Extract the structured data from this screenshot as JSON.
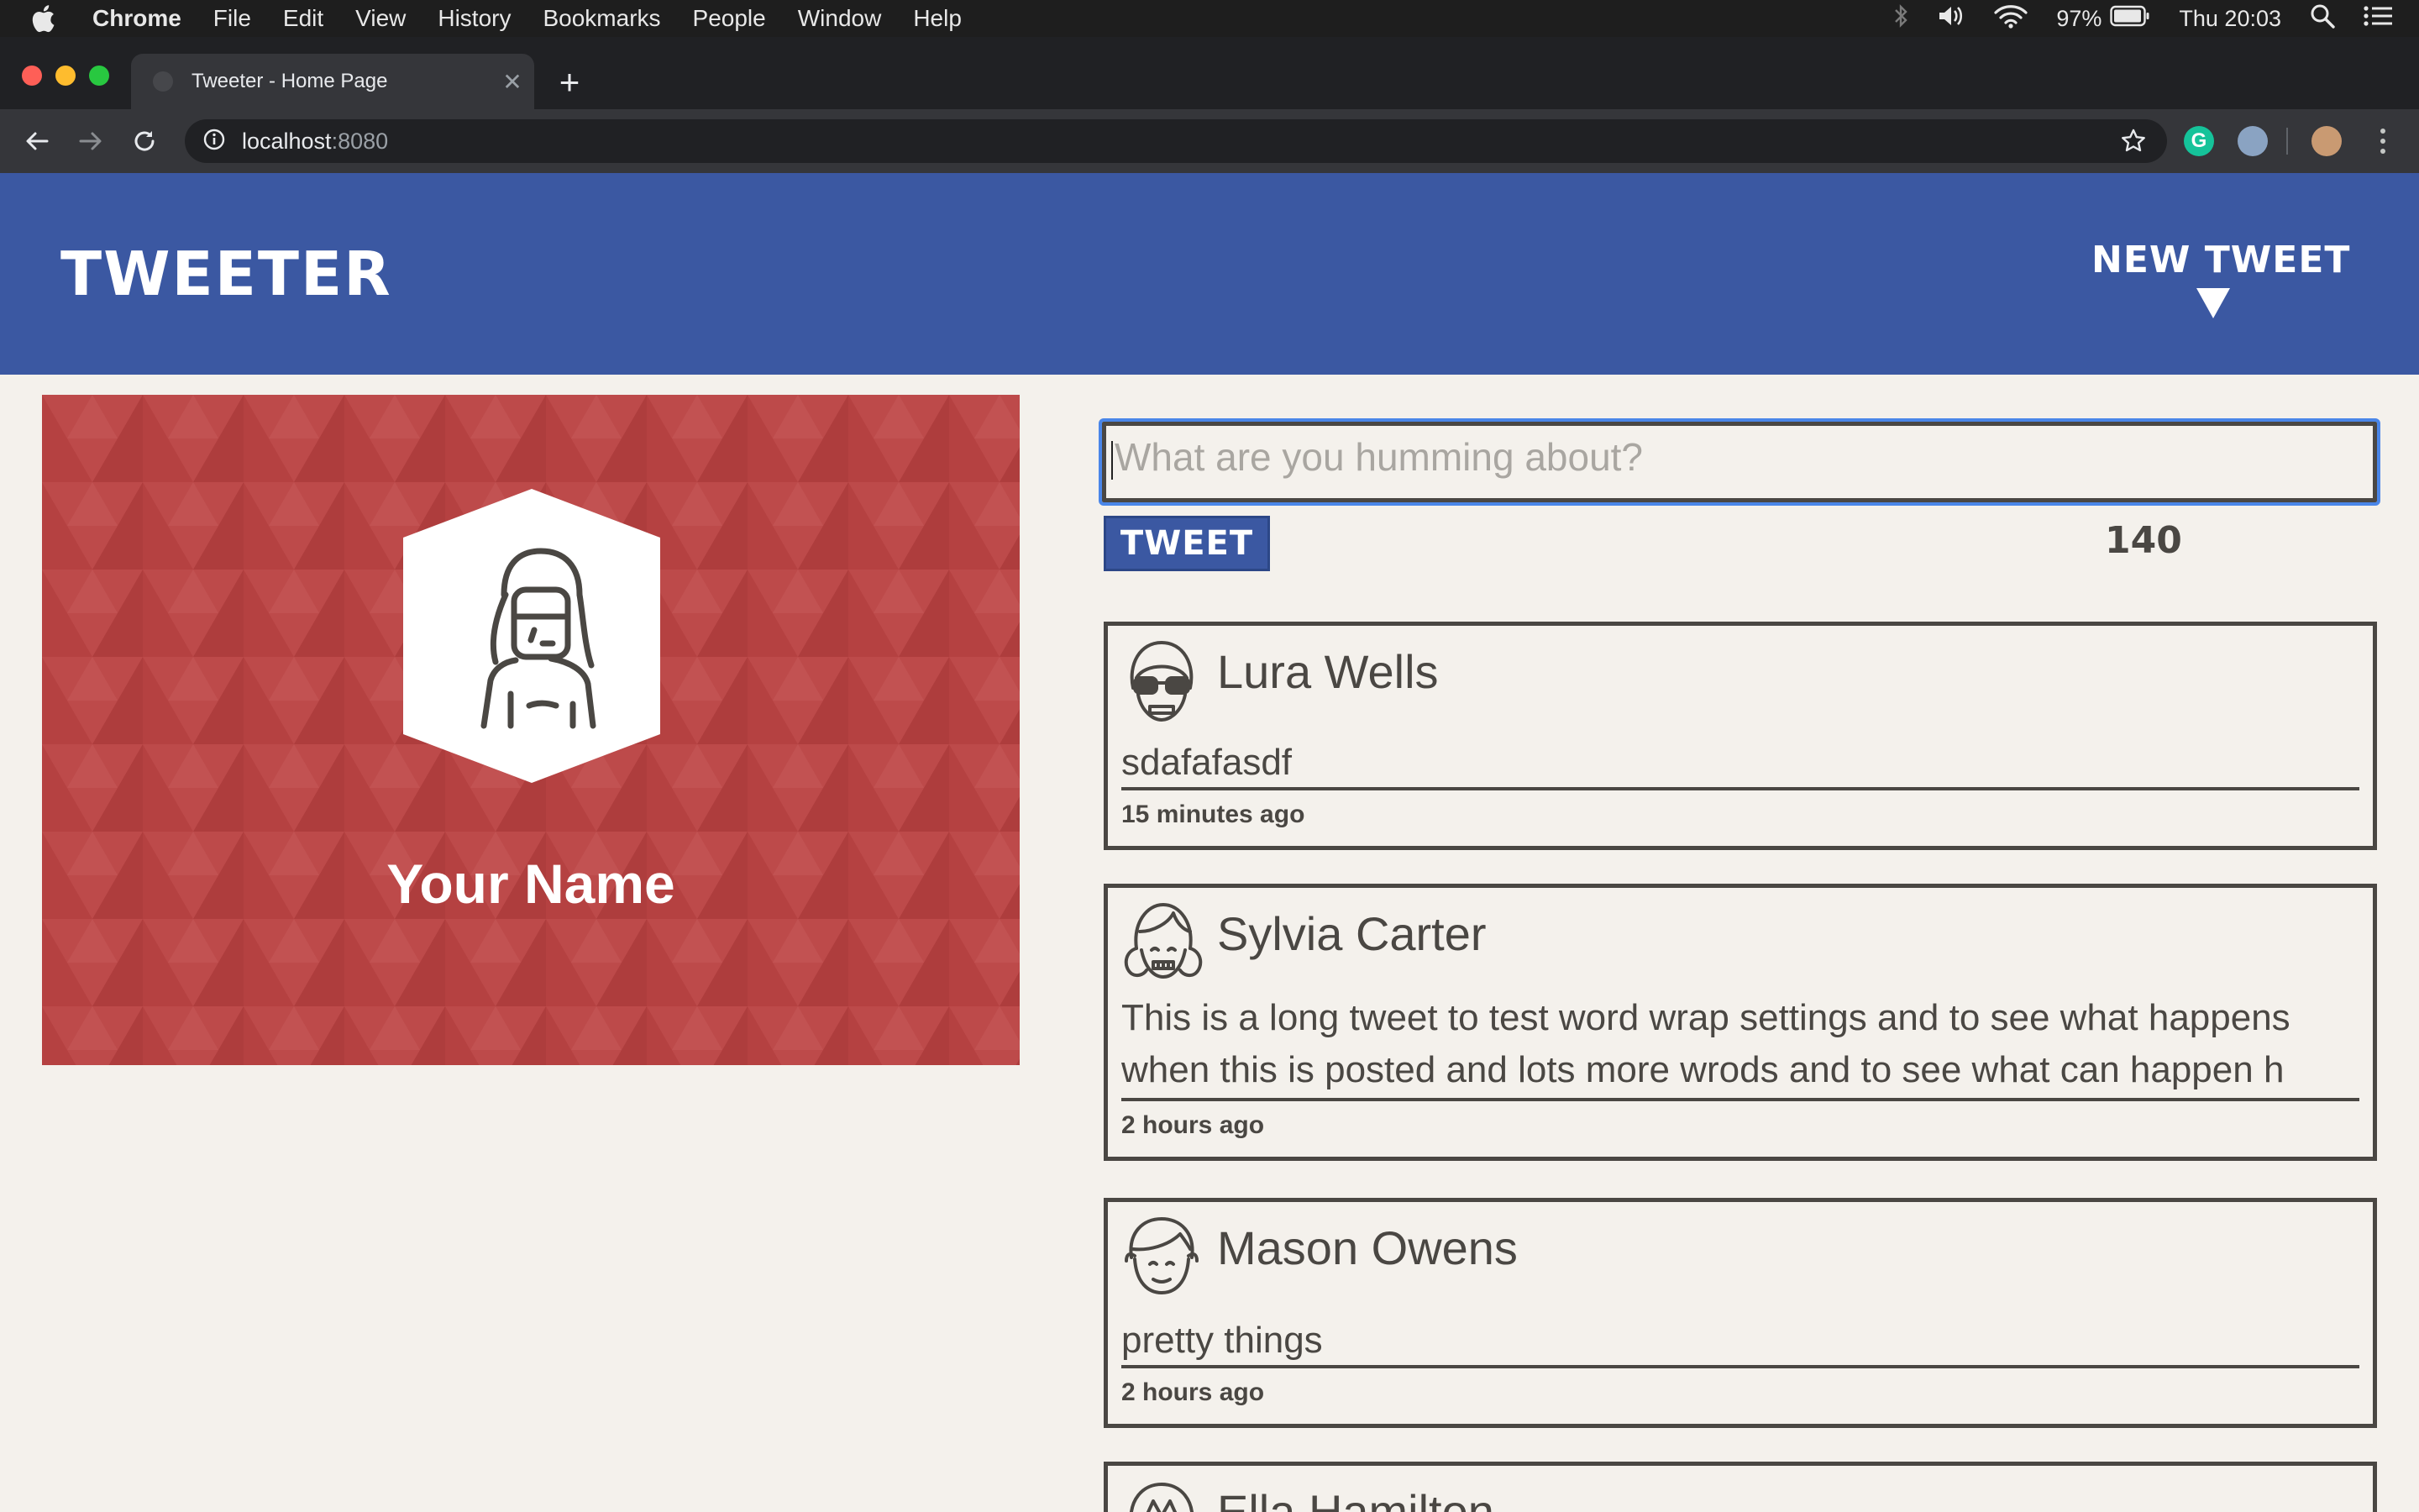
{
  "menubar": {
    "app_name": "Chrome",
    "items": [
      "File",
      "Edit",
      "View",
      "History",
      "Bookmarks",
      "People",
      "Window",
      "Help"
    ],
    "battery": "97%",
    "clock": "Thu 20:03"
  },
  "browser": {
    "tab_title": "Tweeter - Home Page",
    "url_host": "localhost",
    "url_port": ":8080"
  },
  "header": {
    "brand": "TWEETER",
    "new_tweet": "NEW TWEET"
  },
  "profile": {
    "name": "Your Name"
  },
  "composer": {
    "placeholder": "What are you humming about?",
    "button": "TWEET",
    "counter": "140"
  },
  "tweets": [
    {
      "name": "Lura Wells",
      "body": [
        "sdafafasdf"
      ],
      "time": "15 minutes ago"
    },
    {
      "name": "Sylvia Carter",
      "body": [
        "This is a long tweet to test word wrap settings and to see what happens",
        "when this is posted and lots more wrods and to see what can happen h"
      ],
      "time": "2 hours ago"
    },
    {
      "name": "Mason Owens",
      "body": [
        "pretty things"
      ],
      "time": "2 hours ago"
    },
    {
      "name": "Ella Hamilton",
      "body": [],
      "time": ""
    }
  ],
  "colors": {
    "header_blue": "#3b58a2",
    "profile_red": "#b54141",
    "page_bg": "#f4f1ec",
    "ink": "#4a4743"
  }
}
